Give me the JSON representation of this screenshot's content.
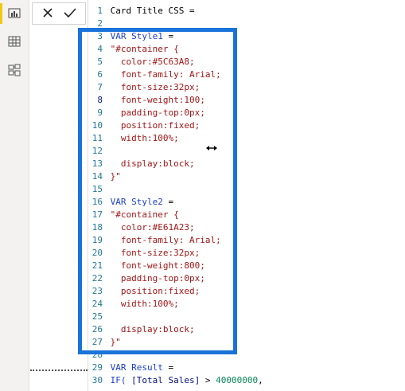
{
  "toolbar": {
    "cancel_icon": "close-icon",
    "commit_icon": "check-icon"
  },
  "rail": {
    "icons": [
      "report-view-icon",
      "data-view-icon",
      "model-view-icon"
    ],
    "accent": "#f2c811"
  },
  "highlight_color": "#1a73d9",
  "editor": {
    "lines": [
      {
        "n": "1",
        "segments": [
          {
            "t": "Card Title CSS =",
            "c": "plain"
          }
        ]
      },
      {
        "n": "2",
        "segments": []
      },
      {
        "n": "3",
        "segments": [
          {
            "t": "VAR Style1",
            "c": "kw"
          },
          {
            "t": " =",
            "c": "plain"
          }
        ]
      },
      {
        "n": "4",
        "segments": [
          {
            "t": "\"#container {",
            "c": "str"
          }
        ]
      },
      {
        "n": "5",
        "segments": [
          {
            "t": "  color:#5C63A8;",
            "c": "str"
          }
        ]
      },
      {
        "n": "6",
        "segments": [
          {
            "t": "  font-family: Arial;",
            "c": "str"
          }
        ]
      },
      {
        "n": "7",
        "segments": [
          {
            "t": "  font-size:32px;",
            "c": "str"
          }
        ]
      },
      {
        "n": "8",
        "segments": [
          {
            "t": "  font-weight:100;",
            "c": "str"
          }
        ]
      },
      {
        "n": "9",
        "segments": [
          {
            "t": "  padding-top:0px;",
            "c": "str"
          }
        ]
      },
      {
        "n": "10",
        "segments": [
          {
            "t": "  position:fixed;",
            "c": "str"
          }
        ]
      },
      {
        "n": "11",
        "segments": [
          {
            "t": "  width:100%;",
            "c": "str"
          }
        ]
      },
      {
        "n": "12",
        "segments": [
          {
            "t": "",
            "c": "str"
          }
        ]
      },
      {
        "n": "13",
        "segments": [
          {
            "t": "  display:block;",
            "c": "str"
          }
        ]
      },
      {
        "n": "14",
        "segments": [
          {
            "t": "}\"",
            "c": "str"
          }
        ]
      },
      {
        "n": "15",
        "segments": []
      },
      {
        "n": "16",
        "segments": [
          {
            "t": "VAR Style2",
            "c": "kw"
          },
          {
            "t": " =",
            "c": "plain"
          }
        ]
      },
      {
        "n": "17",
        "segments": [
          {
            "t": "\"#container {",
            "c": "str"
          }
        ]
      },
      {
        "n": "18",
        "segments": [
          {
            "t": "  color:#E61A23;",
            "c": "str"
          }
        ]
      },
      {
        "n": "19",
        "segments": [
          {
            "t": "  font-family: Arial;",
            "c": "str"
          }
        ]
      },
      {
        "n": "20",
        "segments": [
          {
            "t": "  font-size:32px;",
            "c": "str"
          }
        ]
      },
      {
        "n": "21",
        "segments": [
          {
            "t": "  font-weight:800;",
            "c": "str"
          }
        ]
      },
      {
        "n": "22",
        "segments": [
          {
            "t": "  padding-top:0px;",
            "c": "str"
          }
        ]
      },
      {
        "n": "23",
        "segments": [
          {
            "t": "  position:fixed;",
            "c": "str"
          }
        ]
      },
      {
        "n": "24",
        "segments": [
          {
            "t": "  width:100%;",
            "c": "str"
          }
        ]
      },
      {
        "n": "25",
        "segments": [
          {
            "t": "",
            "c": "str"
          }
        ]
      },
      {
        "n": "26",
        "segments": [
          {
            "t": "  display:block;",
            "c": "str"
          }
        ]
      },
      {
        "n": "27",
        "segments": [
          {
            "t": "}\"",
            "c": "str"
          }
        ]
      },
      {
        "n": "28",
        "segments": []
      },
      {
        "n": "29",
        "segments": [
          {
            "t": "VAR Result",
            "c": "kw"
          },
          {
            "t": " =",
            "c": "plain"
          }
        ]
      },
      {
        "n": "30",
        "segments": [
          {
            "t": "IF(",
            "c": "kw"
          },
          {
            "t": " [Total Sales]",
            "c": "col"
          },
          {
            "t": " > ",
            "c": "plain"
          },
          {
            "t": "40000000",
            "c": "num"
          },
          {
            "t": ",",
            "c": "plain"
          }
        ]
      }
    ]
  }
}
